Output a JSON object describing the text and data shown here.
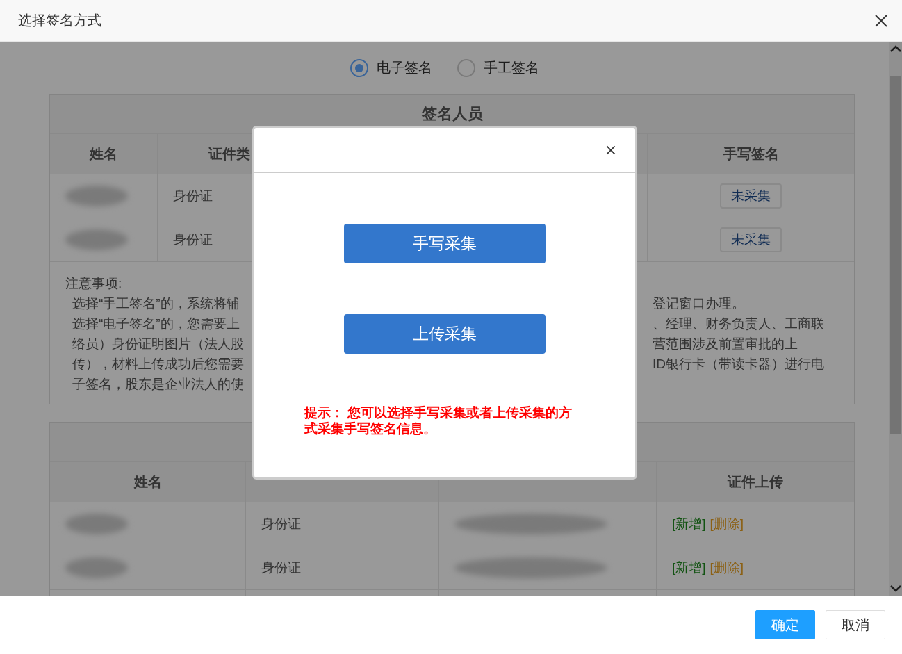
{
  "window": {
    "title": "选择签名方式"
  },
  "signature_modes": [
    {
      "label": "电子签名",
      "selected": true
    },
    {
      "label": "手工签名",
      "selected": false
    }
  ],
  "signers_table": {
    "title": "签名人员",
    "columns": [
      "姓名",
      "证件类",
      "",
      "手写签名"
    ],
    "rows": [
      {
        "id_type": "身份证",
        "signature": "未采集"
      },
      {
        "id_type": "身份证",
        "signature": "未采集"
      }
    ]
  },
  "notes": [
    {
      "left": "注意事项:"
    },
    {
      "left": "选择“手工签名”的，系统将辅",
      "right": "登记窗口办理。"
    },
    {
      "left": "选择“电子签名”的，您需要上",
      "right": "、经理、财务负责人、工商联"
    },
    {
      "left": "络员）身份证明图片（法人股",
      "right": "营范围涉及前置审批的上"
    },
    {
      "left": "传），材料上传成功后您需要",
      "right": "ID银行卡（带读卡器）进行电"
    },
    {
      "left": "子签名，股东是企业法人的使"
    }
  ],
  "upload_table": {
    "columns": [
      "姓名",
      "",
      "",
      "证件上传"
    ],
    "rows": [
      {
        "id_type": "身份证",
        "actions": [
          {
            "label": "[新增]",
            "kind": "add"
          },
          {
            "label": "[删除]",
            "kind": "delete"
          }
        ]
      },
      {
        "id_type": "身份证",
        "actions": [
          {
            "label": "[新增]",
            "kind": "add"
          },
          {
            "label": "[删除]",
            "kind": "delete"
          }
        ]
      }
    ]
  },
  "modal": {
    "buttons": [
      "手写采集",
      "上传采集"
    ],
    "hint": "提示： 您可以选择手写采集或者上传采集的方式采集手写签名信息。"
  },
  "footer": {
    "buttons": [
      {
        "label": "确定",
        "kind": "primary"
      },
      {
        "label": "取消",
        "kind": "default"
      }
    ]
  }
}
